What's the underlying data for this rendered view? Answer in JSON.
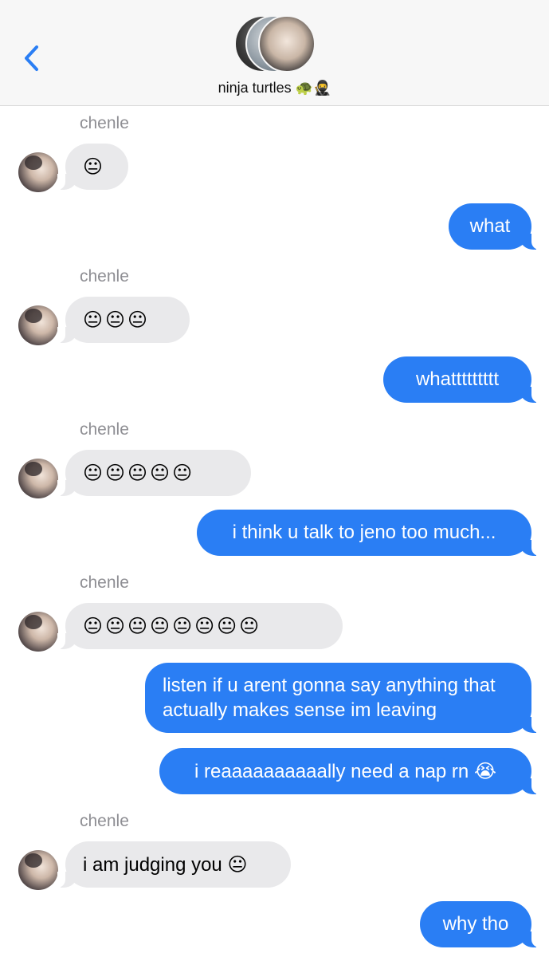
{
  "header": {
    "group_name": "ninja turtles 🐢🥷",
    "back_icon": "chevron-left-icon",
    "accent": "#2a7ef4"
  },
  "messages": [
    {
      "from": "chenle",
      "direction": "incoming",
      "sender_label": "chenle",
      "text": "😐"
    },
    {
      "from": "me",
      "direction": "outgoing",
      "text": "what"
    },
    {
      "from": "chenle",
      "direction": "incoming",
      "sender_label": "chenle",
      "text": "😐😐😐"
    },
    {
      "from": "me",
      "direction": "outgoing",
      "text": "whattttttttt"
    },
    {
      "from": "chenle",
      "direction": "incoming",
      "sender_label": "chenle",
      "text": "😐😐😐😐😐"
    },
    {
      "from": "me",
      "direction": "outgoing",
      "text": "i think u talk to jeno too much..."
    },
    {
      "from": "chenle",
      "direction": "incoming",
      "sender_label": "chenle",
      "text": "😐😐😐😐😐😐😐😐"
    },
    {
      "from": "me",
      "direction": "outgoing",
      "text": "listen if u arent gonna say anything that actually makes sense im leaving"
    },
    {
      "from": "me",
      "direction": "outgoing",
      "text": "i reaaaaaaaaaally need a nap rn 😭"
    },
    {
      "from": "chenle",
      "direction": "incoming",
      "sender_label": "chenle",
      "text": "i am judging you 😐"
    },
    {
      "from": "me",
      "direction": "outgoing",
      "text": "why tho"
    }
  ],
  "colors": {
    "outgoing_bubble": "#2a7ef4",
    "incoming_bubble": "#e9e9eb",
    "sender_label": "#8e8e93"
  }
}
